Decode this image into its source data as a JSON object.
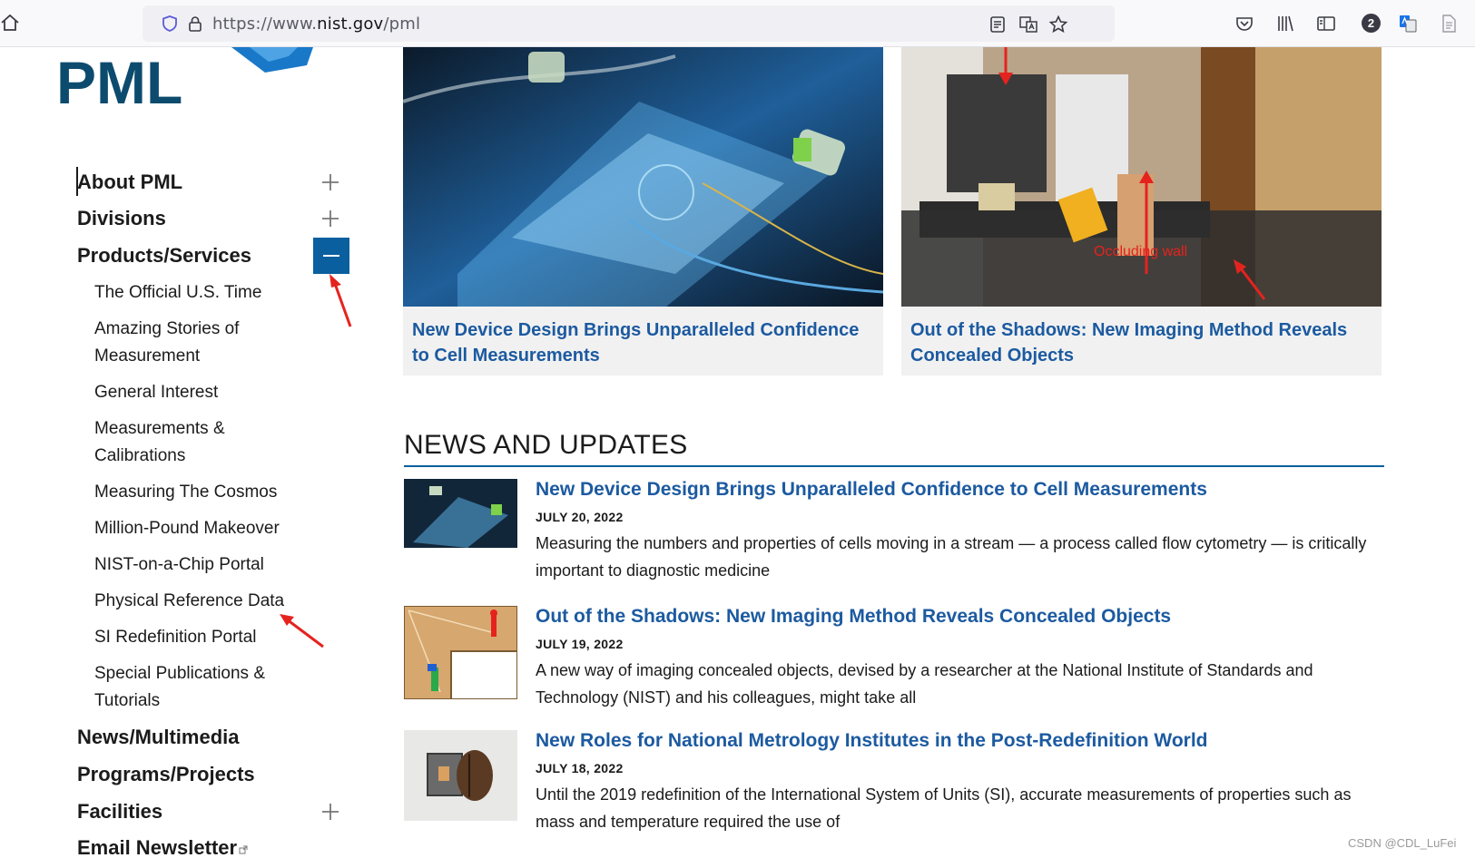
{
  "browser": {
    "url_prefix": "https://www.",
    "url_domain": "nist.gov",
    "url_path": "/pml",
    "profile_badge": "2"
  },
  "logo": {
    "text": "PML"
  },
  "nav": {
    "top_items": [
      {
        "label": "About PML",
        "expand": "plus"
      },
      {
        "label": "Divisions",
        "expand": "plus"
      },
      {
        "label": "Products/Services",
        "expand": "minus"
      }
    ],
    "sub_items": [
      "The Official U.S. Time",
      "Amazing Stories of Measurement",
      "General Interest",
      "Measurements & Calibrations",
      "Measuring The Cosmos",
      "Million-Pound Makeover",
      "NIST-on-a-Chip Portal",
      "Physical Reference Data",
      "SI Redefinition Portal",
      "Special Publications & Tutorials"
    ],
    "bottom_items": [
      {
        "label": "News/Multimedia"
      },
      {
        "label": "Programs/Projects"
      },
      {
        "label": "Facilities",
        "expand": "plus"
      },
      {
        "label": "Email Newsletter"
      }
    ]
  },
  "featured": [
    {
      "title": "New Device Design Brings Unparalleled Confidence to Cell Measurements"
    },
    {
      "title": "Out of the Shadows: New Imaging Method Reveals Concealed Objects",
      "image_caption": "Occluding wall"
    }
  ],
  "news": {
    "heading": "NEWS AND UPDATES",
    "items": [
      {
        "title": "New Device Design Brings Unparalleled Confidence to Cell Measurements",
        "date": "JULY 20, 2022",
        "summary": "Measuring the numbers and properties of cells moving in a stream — a process called flow cytometry — is critically important to diagnostic medicine"
      },
      {
        "title": "Out of the Shadows: New Imaging Method Reveals Concealed Objects",
        "date": "JULY 19, 2022",
        "summary": "A new way of imaging concealed objects, devised by a researcher at the National Institute of Standards and Technology (NIST) and his colleagues, might take all"
      },
      {
        "title": "New Roles for National Metrology Institutes in the Post-Redefinition World",
        "date": "JULY 18, 2022",
        "summary": "Until the 2019 redefinition of the International System of Units (SI), accurate measurements of properties such as mass and temperature required the use of"
      }
    ]
  },
  "watermark": "CSDN @CDL_LuFei",
  "colors": {
    "nist_blue": "#0a5f9e",
    "link_blue": "#1c5aa0",
    "annotation_red": "#e5231e"
  }
}
